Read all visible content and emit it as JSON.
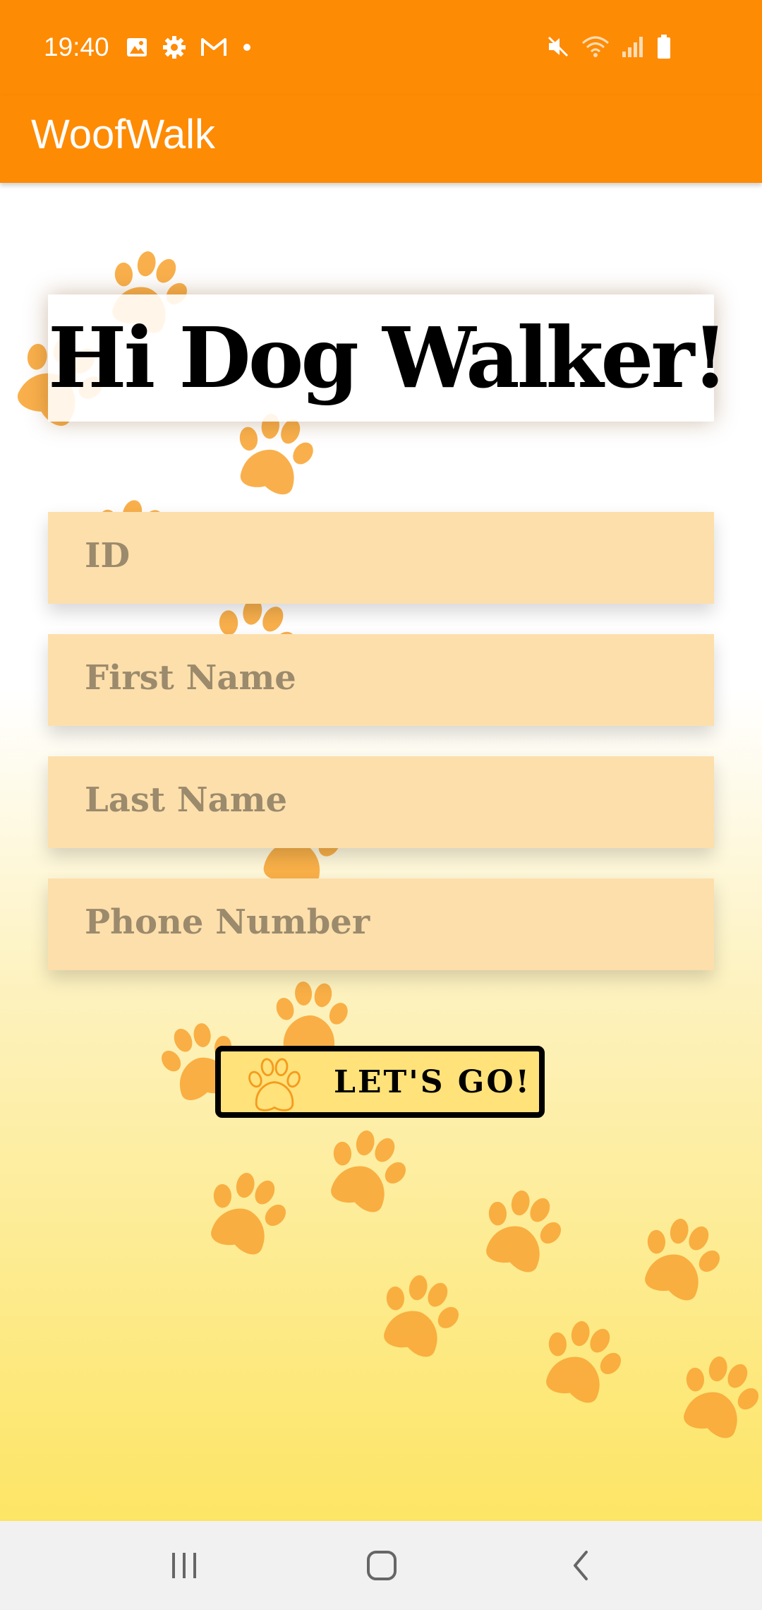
{
  "status_bar": {
    "time": "19:40",
    "left_icons": [
      "image-icon",
      "gear-icon",
      "gmail-icon",
      "dot-icon"
    ],
    "right_icons": [
      "mute-icon",
      "wifi-icon",
      "signal-icon",
      "battery-icon"
    ]
  },
  "app_bar": {
    "title": "WoofWalk"
  },
  "main": {
    "headline": "Hi Dog Walker!",
    "fields": [
      {
        "placeholder": "ID"
      },
      {
        "placeholder": "First Name"
      },
      {
        "placeholder": "Last Name"
      },
      {
        "placeholder": "Phone Number"
      }
    ],
    "submit_label": "LET'S GO!"
  },
  "nav_bar": {
    "buttons": [
      "recents-button",
      "home-button",
      "back-button"
    ]
  },
  "colors": {
    "app_bar": "#fe8b04",
    "field_background": "#fddfac",
    "field_text": "#9b8a6c",
    "paw_print": "#f9a838",
    "button_background": "#ffe27a",
    "gradient_end": "#fde565"
  }
}
